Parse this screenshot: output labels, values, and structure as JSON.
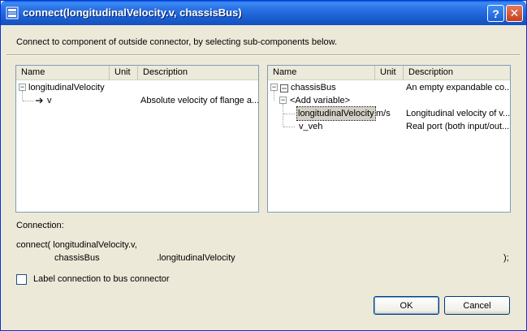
{
  "window": {
    "title": "connect(longitudinalVelocity.v, chassisBus)",
    "help_glyph": "?",
    "close_glyph": "✕"
  },
  "instruction": "Connect to component of outside connector, by selecting sub-components below.",
  "left_tree": {
    "columns": [
      "Name",
      "Unit",
      "Description"
    ],
    "rows": [
      {
        "expander": "−",
        "name": "longitudinalVelocity",
        "unit": "",
        "description": ""
      },
      {
        "expander": "",
        "name": "v",
        "unit": "",
        "description": "Absolute velocity of flange a..."
      }
    ]
  },
  "right_tree": {
    "columns": [
      "Name",
      "Unit",
      "Description"
    ],
    "rows": [
      {
        "expander": "−",
        "name": "chassisBus",
        "unit": "",
        "description": "An empty expandable co..."
      },
      {
        "expander": "−",
        "name": "<Add variable>",
        "unit": "",
        "description": ""
      },
      {
        "expander": "",
        "name": "longitudinalVelocity",
        "unit": "m/s",
        "description": "Longitudinal velocity of v..."
      },
      {
        "expander": "",
        "name": "v_veh",
        "unit": "",
        "description": "Real port (both input/out..."
      }
    ]
  },
  "connection": {
    "label": "Connection:",
    "line1": "connect( longitudinalVelocity.v,",
    "bus": "chassisBus",
    "member": ".longitudinalVelocity",
    "end": ");"
  },
  "checkbox_label": "Label connection to bus connector",
  "buttons": {
    "ok": "OK",
    "cancel": "Cancel"
  }
}
